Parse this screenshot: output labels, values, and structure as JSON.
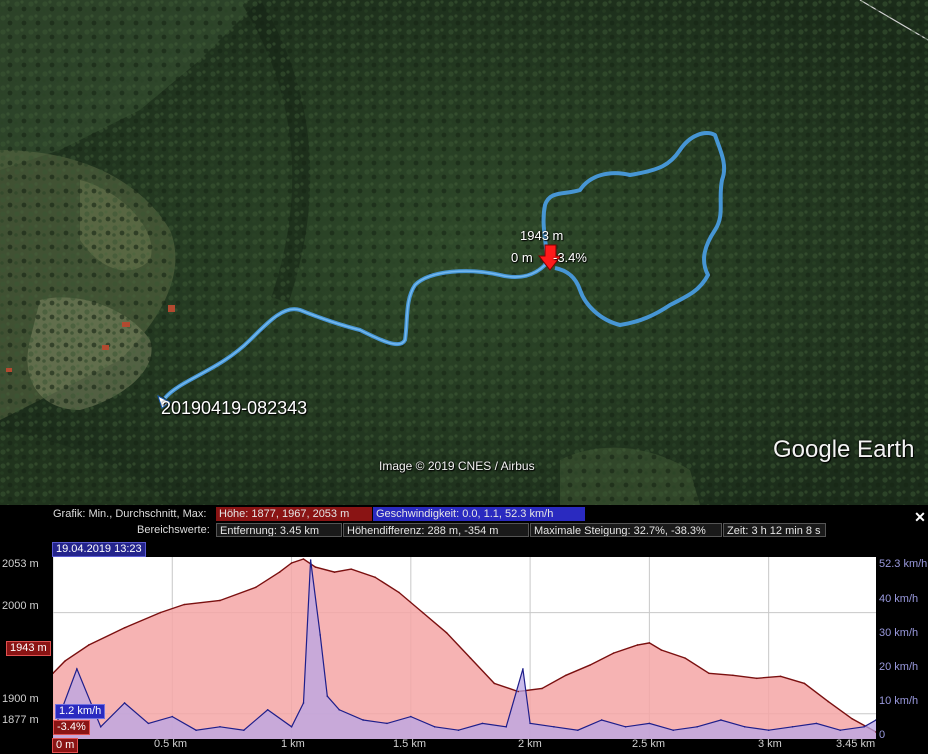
{
  "map": {
    "track_name": "20190419-082343",
    "marker_elevation": "1943 m",
    "marker_distance": "0 m",
    "marker_grade": "-3.4%",
    "attribution": "Image © 2019 CNES / Airbus",
    "logo": "Google Earth"
  },
  "panel": {
    "graph_label": "Grafik: Min., Durchschnitt, Max:",
    "height_stat": "Höhe: 1877, 1967, 2053 m",
    "speed_stat": "Geschwindigkeit: 0.0, 1.1, 52.3 km/h",
    "range_label": "Bereichswerte:",
    "distance_stat": "Entfernung: 3.45 km",
    "elev_diff_stat": "Höhendifferenz: 288 m, -354 m",
    "max_grade_stat": "Maximale Steigung: 32.7%, -38.3%",
    "time_stat": "Zeit: 3 h 12 min 8 s",
    "date_badge": "19.04.2019 13:23",
    "close_icon": "close-icon"
  },
  "chart_data": {
    "type": "area",
    "x_unit": "km",
    "xlim": [
      0,
      3.45
    ],
    "y_left_lim": [
      1877,
      2053
    ],
    "y_right_lim": [
      0,
      52.3
    ],
    "x_ticks": [
      "0 m",
      "0.5 km",
      "1 km",
      "1.5 km",
      "2 km",
      "2.5 km",
      "3 km",
      "3.45 km"
    ],
    "y_left_ticks": [
      "2053 m",
      "2000 m",
      "1900 m",
      "1877 m"
    ],
    "y_right_ticks": [
      "52.3 km/h",
      "40 km/h",
      "30 km/h",
      "20 km/h",
      "10 km/h",
      "0"
    ],
    "cursor_elevation": "1943 m",
    "cursor_speed": "1.2 km/h",
    "cursor_grade": "-3.4%",
    "cursor_distance": "0 m",
    "series": [
      {
        "name": "Höhe",
        "color": "#7a1010",
        "fill": "#f4a6a6",
        "x": [
          0,
          0.05,
          0.15,
          0.3,
          0.45,
          0.55,
          0.7,
          0.85,
          0.95,
          1.0,
          1.05,
          1.1,
          1.18,
          1.25,
          1.35,
          1.45,
          1.55,
          1.65,
          1.75,
          1.85,
          1.95,
          2.05,
          2.15,
          2.25,
          2.35,
          2.45,
          2.5,
          2.55,
          2.65,
          2.75,
          2.85,
          2.95,
          3.05,
          3.15,
          3.25,
          3.35,
          3.45
        ],
        "values": [
          1940,
          1952,
          1968,
          1985,
          2000,
          2008,
          2012,
          2025,
          2040,
          2049,
          2053,
          2045,
          2040,
          2043,
          2035,
          2020,
          2000,
          1980,
          1955,
          1930,
          1922,
          1925,
          1938,
          1948,
          1960,
          1968,
          1970,
          1963,
          1955,
          1940,
          1938,
          1935,
          1937,
          1930,
          1912,
          1895,
          1882
        ]
      },
      {
        "name": "Geschwindigkeit",
        "color": "#1e1e8a",
        "fill": "#b8a6e6",
        "x": [
          0,
          0.1,
          0.2,
          0.3,
          0.4,
          0.5,
          0.6,
          0.7,
          0.8,
          0.9,
          1.0,
          1.05,
          1.08,
          1.12,
          1.15,
          1.2,
          1.3,
          1.4,
          1.5,
          1.6,
          1.7,
          1.8,
          1.9,
          1.97,
          2.0,
          2.1,
          2.2,
          2.3,
          2.4,
          2.5,
          2.6,
          2.7,
          2.8,
          2.9,
          3.0,
          3.1,
          3.2,
          3.3,
          3.4,
          3.45
        ],
        "values": [
          1.2,
          20,
          3,
          10,
          4,
          6,
          2,
          3,
          2,
          8,
          3,
          10,
          52,
          30,
          12,
          8,
          5,
          4,
          6,
          3,
          2,
          4,
          3,
          20,
          4,
          3,
          2,
          5,
          3,
          4,
          2,
          3,
          5,
          3,
          2,
          3,
          4,
          2,
          3,
          5
        ]
      }
    ]
  }
}
